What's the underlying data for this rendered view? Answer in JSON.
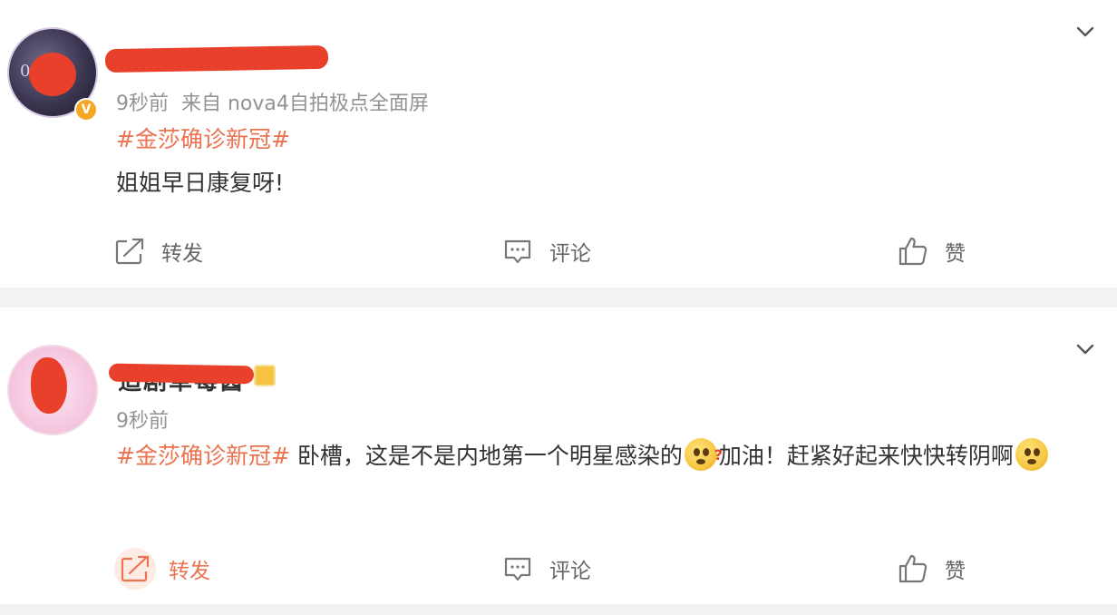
{
  "posts": [
    {
      "meta_time": "9秒前",
      "meta_source": "来自 nova4自拍极点全面屏",
      "avatar_text": "06  03",
      "hashtag": "#金莎确诊新冠#",
      "text": "姐姐早日康复呀!",
      "verified": true,
      "actions": {
        "repost": "转发",
        "comment": "评论",
        "like": "赞"
      },
      "repost_active": false
    },
    {
      "name": "追剧草莓酱",
      "meta_time": "9秒前",
      "hashtag": "#金莎确诊新冠#",
      "text_before_emoji": " 卧槽，这是不是内地第一个明星感染的",
      "emoji_1": "doubt-emoji",
      "text_after_emoji": "加油！赶紧好起来快快转阴啊",
      "emoji_2": "pleading-emoji",
      "actions": {
        "repost": "转发",
        "comment": "评论",
        "like": "赞"
      },
      "repost_active": true
    }
  ],
  "colors": {
    "hashtag": "#eb7350",
    "meta": "#939393",
    "text": "#333333",
    "redaction": "#e8402a",
    "separator": "#f2f2f2",
    "verified": "#f5a623"
  }
}
